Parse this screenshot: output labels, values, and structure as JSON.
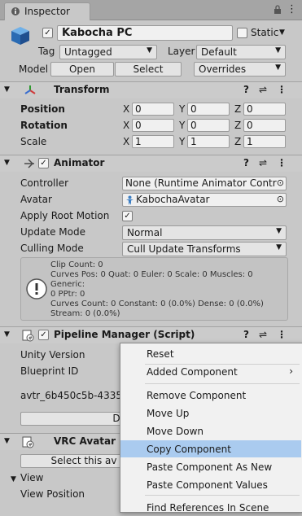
{
  "tab": {
    "title": "Inspector"
  },
  "object": {
    "name": "Kabocha PC",
    "static_label": "Static",
    "tag_label": "Tag",
    "tag_value": "Untagged",
    "layer_label": "Layer",
    "layer_value": "Default",
    "model_label": "Model",
    "open_label": "Open",
    "select_label": "Select",
    "overrides_label": "Overrides"
  },
  "transform": {
    "title": "Transform",
    "rows": [
      {
        "label": "Position",
        "x": "0",
        "y": "0",
        "z": "0"
      },
      {
        "label": "Rotation",
        "x": "0",
        "y": "0",
        "z": "0"
      },
      {
        "label": "Scale",
        "x": "1",
        "y": "1",
        "z": "1"
      }
    ],
    "axis_x": "X",
    "axis_y": "Y",
    "axis_z": "Z"
  },
  "animator": {
    "title": "Animator",
    "controller_label": "Controller",
    "controller_value": "None (Runtime Animator Control",
    "avatar_label": "Avatar",
    "avatar_value": "KabochaAvatar",
    "apply_root_motion_label": "Apply Root Motion",
    "update_mode_label": "Update Mode",
    "update_mode_value": "Normal",
    "culling_mode_label": "Culling Mode",
    "culling_mode_value": "Cull Update Transforms",
    "info_lines": [
      "Clip Count: 0",
      "Curves Pos: 0 Quat: 0 Euler: 0 Scale: 0 Muscles: 0 Generic:",
      "0 PPtr: 0",
      "Curves Count: 0 Constant: 0 (0.0%) Dense: 0 (0.0%)",
      "Stream: 0 (0.0%)"
    ]
  },
  "pipeline": {
    "title": "Pipeline Manager (Script)",
    "unity_version_label": "Unity Version",
    "blueprint_id_label": "Blueprint ID",
    "blueprint_value": "avtr_6b450c5b-4335",
    "detach_button": "D"
  },
  "vrc": {
    "title": "VRC Avatar D",
    "select_button": "Select this av",
    "view_label": "View",
    "view_position_label": "View Position"
  },
  "context_menu": {
    "items": [
      {
        "label": "Reset"
      },
      {
        "label": "Added Component",
        "submenu": "›"
      },
      {
        "label": "Remove Component"
      },
      {
        "label": "Move Up"
      },
      {
        "label": "Move Down"
      },
      {
        "label": "Copy Component"
      },
      {
        "label": "Paste Component As New"
      },
      {
        "label": "Paste Component Values"
      },
      {
        "label": "Find References In Scene"
      }
    ]
  },
  "icons": {
    "help": "?",
    "settings": "⇌",
    "more": "⋮",
    "lock": "🔒",
    "tabmenu": "⋮",
    "foldout": "▼",
    "dropdown_arrow": "▼",
    "target": "⊙",
    "check": "✓",
    "info": "!"
  }
}
